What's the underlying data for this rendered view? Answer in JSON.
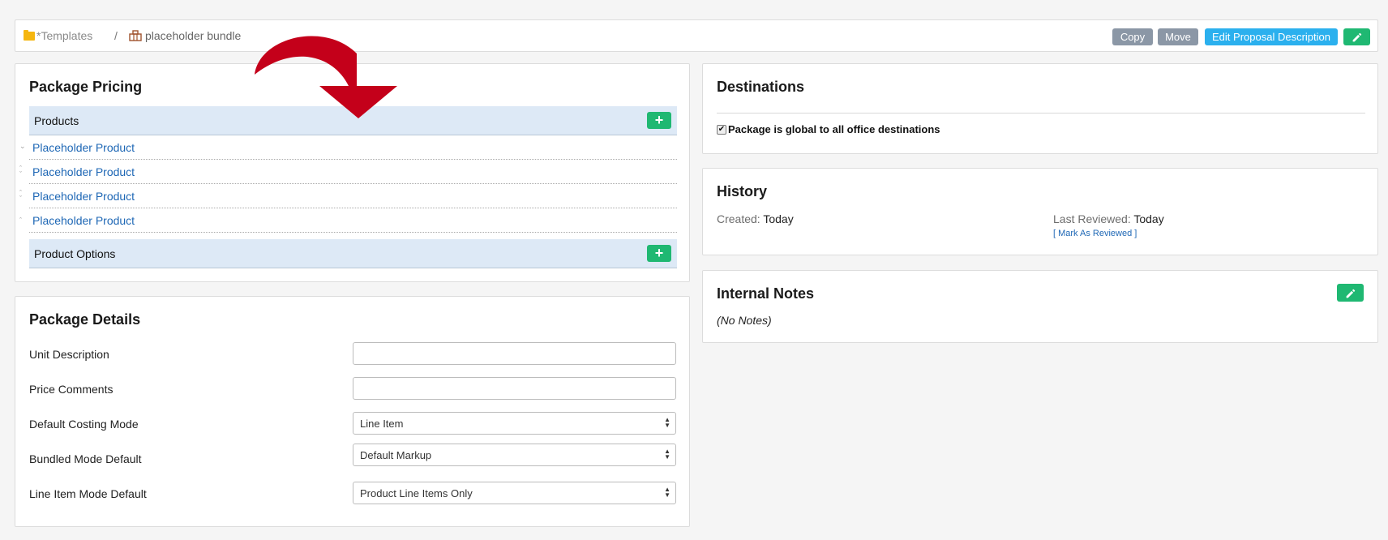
{
  "breadcrumb": {
    "folder": "*Templates",
    "separator": "/",
    "bundle": "placeholder bundle"
  },
  "toolbar": {
    "copy_label": "Copy",
    "move_label": "Move",
    "edit_description_label": "Edit Proposal Description"
  },
  "package_pricing": {
    "title": "Package Pricing",
    "products_label": "Products",
    "products": [
      {
        "label": "Placeholder Product"
      },
      {
        "label": "Placeholder Product"
      },
      {
        "label": "Placeholder Product"
      },
      {
        "label": "Placeholder Product"
      }
    ],
    "product_options_label": "Product Options",
    "add_symbol": "+"
  },
  "package_details": {
    "title": "Package Details",
    "unit_description_label": "Unit Description",
    "unit_description_value": "",
    "price_comments_label": "Price Comments",
    "price_comments_value": "",
    "default_costing_mode_label": "Default Costing Mode",
    "default_costing_mode_value": "Line Item",
    "bundled_mode_default_label": "Bundled Mode Default",
    "bundled_mode_default_value": "Default Markup",
    "line_item_mode_default_label": "Line Item Mode Default",
    "line_item_mode_default_value": "Product Line Items Only"
  },
  "destinations": {
    "title": "Destinations",
    "global_checkbox_label": "Package is global to all office destinations",
    "global_checked": true
  },
  "history": {
    "title": "History",
    "created_label": "Created:",
    "created_value": "Today",
    "last_reviewed_label": "Last Reviewed:",
    "last_reviewed_value": "Today",
    "mark_reviewed_label": "[ Mark As Reviewed ]"
  },
  "internal_notes": {
    "title": "Internal Notes",
    "notes_text": "(No Notes)"
  },
  "colors": {
    "accent_green": "#1fb872",
    "accent_blue": "#2bb0ee",
    "button_gray": "#8b97a6",
    "link_blue": "#1e67b5",
    "section_bar": "#dde9f6",
    "arrow_red": "#c4001a"
  }
}
